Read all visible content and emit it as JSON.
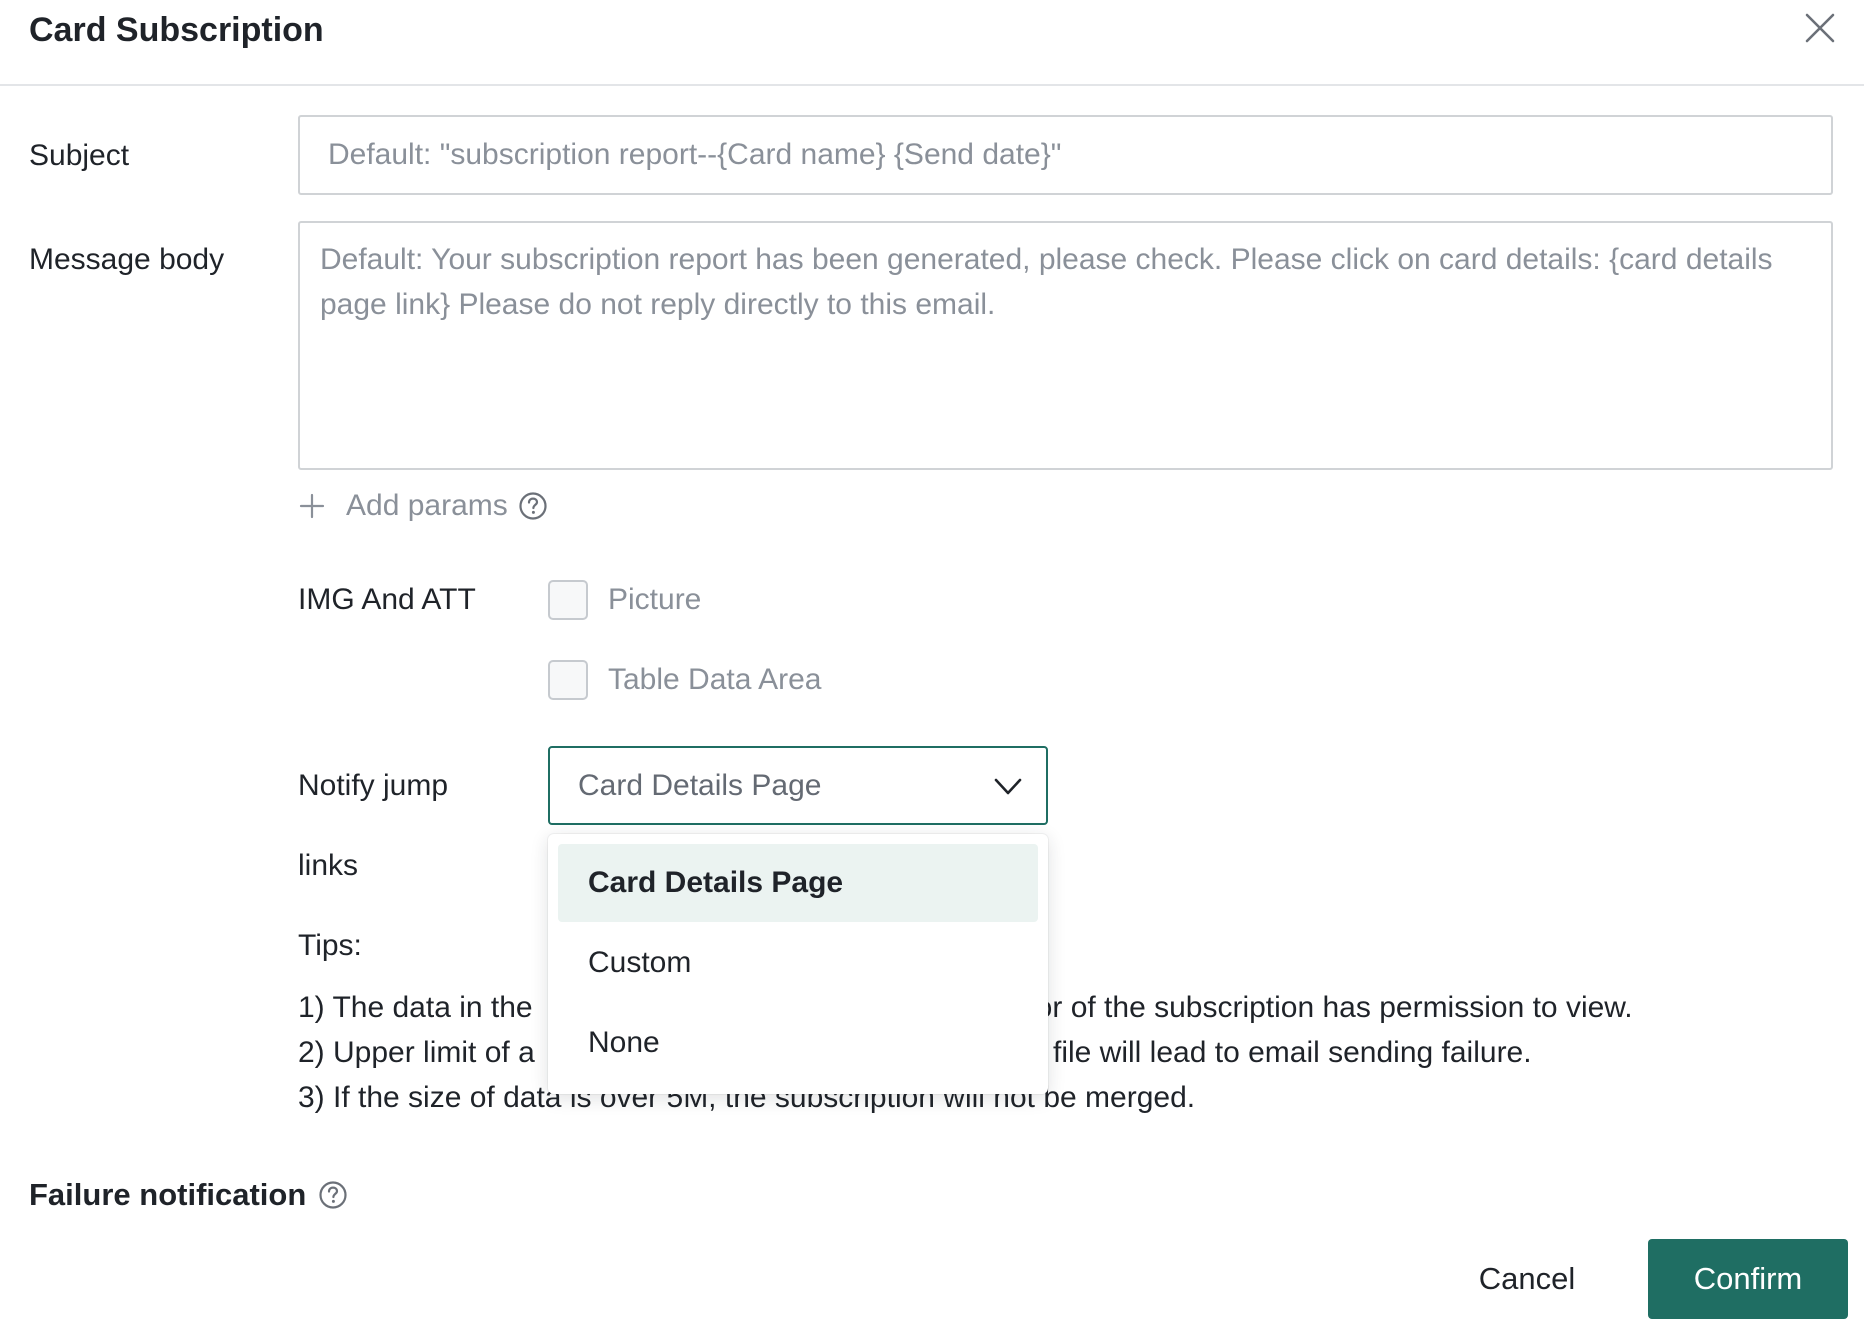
{
  "dialog": {
    "title": "Card Subscription"
  },
  "form": {
    "subject_label": "Subject",
    "subject_placeholder": "Default: \"subscription report--{Card name} {Send date}\"",
    "body_label": "Message body",
    "body_placeholder": "Default: Your subscription report has been generated, please check. Please click on card details: {card details page link} Please do not reply directly to this email.",
    "add_params_label": "Add params",
    "img_att_label": "IMG And ATT",
    "checkboxes": [
      {
        "label": "Picture",
        "checked": false
      },
      {
        "label": "Table Data Area",
        "checked": false
      }
    ],
    "notify_label_line1": "Notify jump",
    "notify_label_line2": "links",
    "notify_selected": "Card Details Page",
    "notify_options": [
      "Card Details Page",
      "Custom",
      "None"
    ],
    "tips_title": "Tips:",
    "tips": [
      "1) The data in the",
      "nor of the subscription has permission to view.",
      "2) Upper limit of a",
      "file will lead to email sending failure.",
      "3) If the size of data is over 5M, the subscription will not be merged."
    ],
    "failure_label": "Failure notification"
  },
  "footer": {
    "cancel_label": "Cancel",
    "confirm_label": "Confirm"
  },
  "colors": {
    "accent": "#1f6e63",
    "selected_option_bg": "#ebf3f1",
    "placeholder": "#8a9099",
    "text": "#1f2329"
  },
  "icons": {
    "close": "close-icon",
    "add": "plus-icon",
    "help": "question-circle-icon",
    "dropdown": "chevron-down-icon"
  }
}
